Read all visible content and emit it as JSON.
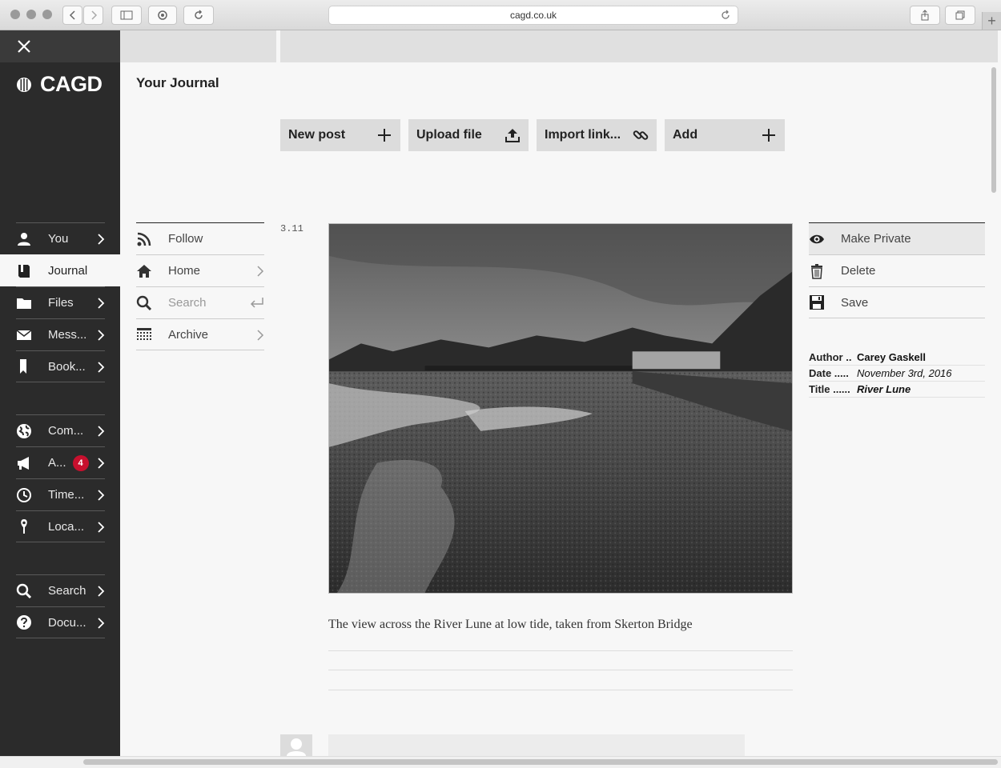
{
  "browser": {
    "url": "cagd.co.uk",
    "back_icon": "chevron-left-icon",
    "forward_icon": "chevron-right-icon",
    "newtab_label": "+"
  },
  "app": {
    "logo": "CAGD",
    "page_title": "Your Journal"
  },
  "sidebar": {
    "items": [
      {
        "label": "You",
        "icon": "person-icon"
      },
      {
        "label": "Journal",
        "icon": "journal-icon",
        "active": true
      },
      {
        "label": "Files",
        "icon": "folder-icon"
      },
      {
        "label": "Mess...",
        "icon": "envelope-icon"
      },
      {
        "label": "Book...",
        "icon": "bookmark-icon"
      },
      {
        "label": "Com...",
        "icon": "globe-icon"
      },
      {
        "label": "A...",
        "icon": "megaphone-icon",
        "badge": "4"
      },
      {
        "label": "Time...",
        "icon": "clock-icon"
      },
      {
        "label": "Loca...",
        "icon": "location-pin-icon"
      },
      {
        "label": "Search",
        "icon": "search-icon"
      },
      {
        "label": "Docu...",
        "icon": "help-icon"
      }
    ]
  },
  "actions": {
    "new_post": "New post",
    "upload_file": "Upload file",
    "import_link": "Import link...",
    "add": "Add"
  },
  "subnav": {
    "follow": "Follow",
    "home": "Home",
    "search_placeholder": "Search",
    "archive": "Archive"
  },
  "post": {
    "date": "3.11",
    "caption": "The view across the River Lune at low tide, taken from Skerton Bridge"
  },
  "tools": {
    "make_private": "Make Private",
    "delete": "Delete",
    "save": "Save"
  },
  "meta": {
    "author_label": "Author ..",
    "author": "Carey Gaskell",
    "date_label": "Date .....",
    "date": "November 3rd, 2016",
    "title_label": "Title ......",
    "title": "River Lune"
  },
  "colors": {
    "sidebar_bg": "#2b2b2b",
    "badge": "#c8102e",
    "button_bg": "#dcdcdc"
  }
}
